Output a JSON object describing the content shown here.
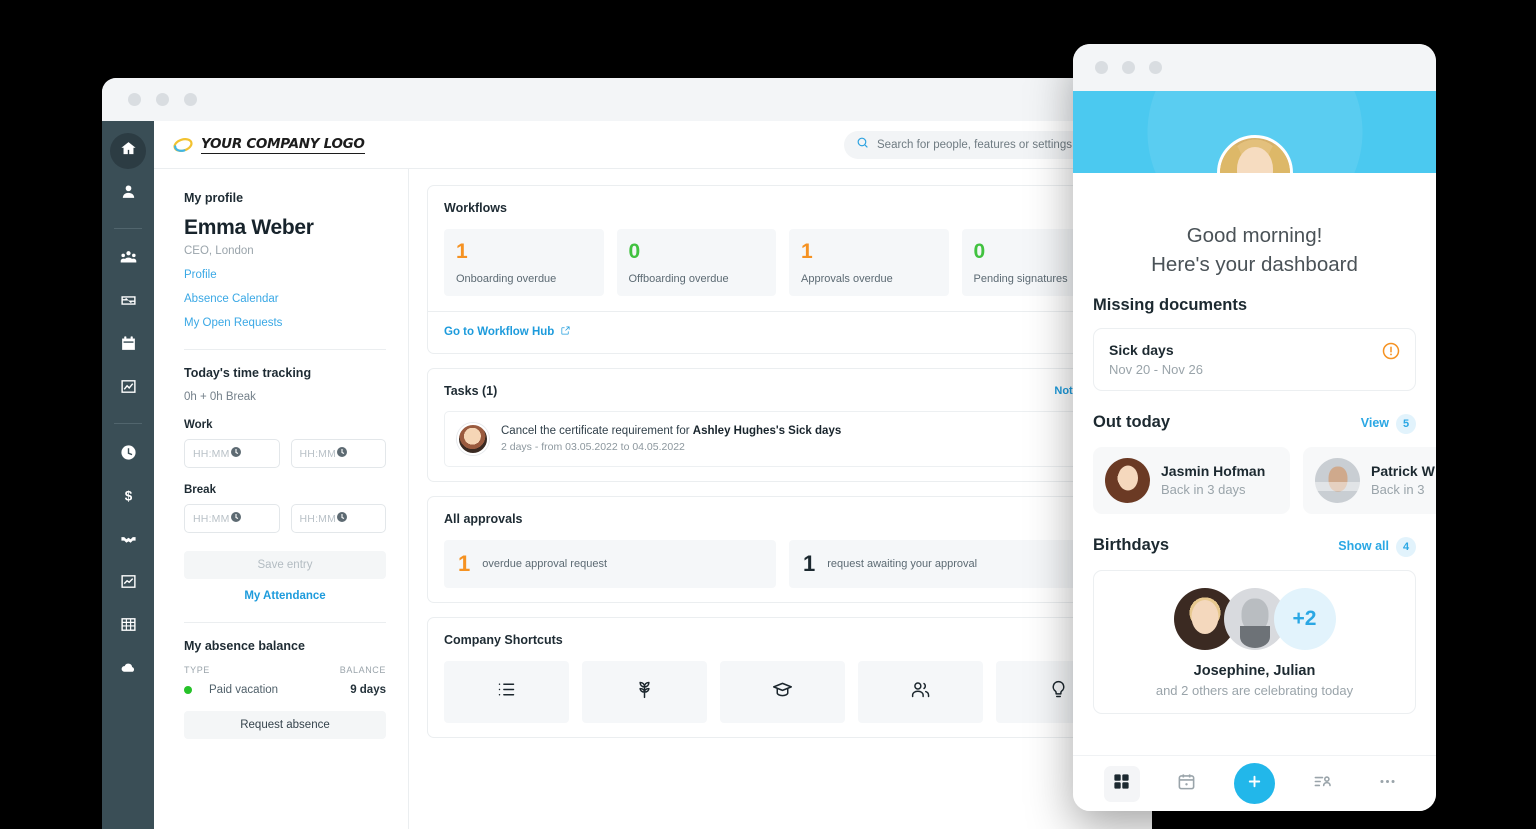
{
  "desktop": {
    "logo_text": "YOUR COMPANY LOGO",
    "search": {
      "placeholder": "Search for people, features or settings",
      "icon": "search-icon"
    },
    "sidebar_icons": [
      "home-icon",
      "person-icon",
      "people-group-icon",
      "recruiting-icon",
      "calendar-icon",
      "reports-icon",
      "clock-icon",
      "dollar-icon",
      "handshake-icon",
      "chart-icon",
      "grid-icon",
      "cloud-icon"
    ],
    "profile": {
      "section_label": "My profile",
      "name": "Emma Weber",
      "role": "CEO, London",
      "links": [
        "Profile",
        "Absence Calendar",
        "My Open Requests"
      ]
    },
    "time_tracking": {
      "title": "Today's time tracking",
      "summary": "0h + 0h Break",
      "work_label": "Work",
      "break_label": "Break",
      "time_placeholder": "HH:MM",
      "save_label": "Save entry",
      "attendance_link": "My Attendance"
    },
    "absence": {
      "title": "My absence balance",
      "col_type": "TYPE",
      "col_balance": "BALANCE",
      "rows": [
        {
          "type": "Paid vacation",
          "balance": "9 days",
          "color": "#26c229"
        }
      ],
      "request_label": "Request absence"
    },
    "workflows": {
      "title": "Workflows",
      "kpis": [
        {
          "value": "1",
          "label": "Onboarding overdue",
          "color": "#f59222"
        },
        {
          "value": "0",
          "label": "Offboarding overdue",
          "color": "#41c240"
        },
        {
          "value": "1",
          "label": "Approvals overdue",
          "color": "#f59222"
        },
        {
          "value": "0",
          "label": "Pending signatures",
          "color": "#41c240"
        }
      ],
      "hub_link": "Go to Workflow Hub"
    },
    "tasks": {
      "title": "Tasks (1)",
      "notifications_link": "Notifications",
      "items": [
        {
          "text_prefix": "Cancel the certificate requirement for ",
          "text_bold": "Ashley Hughes's Sick days",
          "meta": "2 days - from 03.05.2022 to 04.05.2022"
        }
      ]
    },
    "approvals": {
      "title": "All approvals",
      "items": [
        {
          "value": "1",
          "label": "overdue approval request",
          "color": "#f59222"
        },
        {
          "value": "1",
          "label": "request awaiting your approval",
          "color": "#1c2930"
        }
      ]
    },
    "shortcuts": {
      "title": "Company Shortcuts",
      "icons": [
        "list-icon",
        "plant-icon",
        "graduation-cap-icon",
        "people-icon",
        "lightbulb-icon"
      ]
    }
  },
  "mobile": {
    "greeting_line1": "Good morning!",
    "greeting_line2": "Here's your dashboard",
    "missing_documents": {
      "title": "Missing documents",
      "items": [
        {
          "name": "Sick days",
          "dates": "Nov 20 - Nov 26",
          "status_icon": "alert-circle-icon"
        }
      ]
    },
    "out_today": {
      "title": "Out today",
      "link": "View",
      "count": "5",
      "people": [
        {
          "name": "Jasmin Hofman",
          "status": "Back in 3 days"
        },
        {
          "name": "Patrick W",
          "status": "Back in 3 "
        }
      ]
    },
    "birthdays": {
      "title": "Birthdays",
      "link": "Show all",
      "count": "4",
      "extra_avatar": "+2",
      "names": "Josephine, Julian",
      "subtitle": "and 2 others are celebrating today"
    },
    "nav_icons": [
      "dashboard-icon",
      "calendar-icon",
      "add-icon",
      "requests-icon",
      "more-icon"
    ],
    "accent_color": "#22b7ea"
  }
}
